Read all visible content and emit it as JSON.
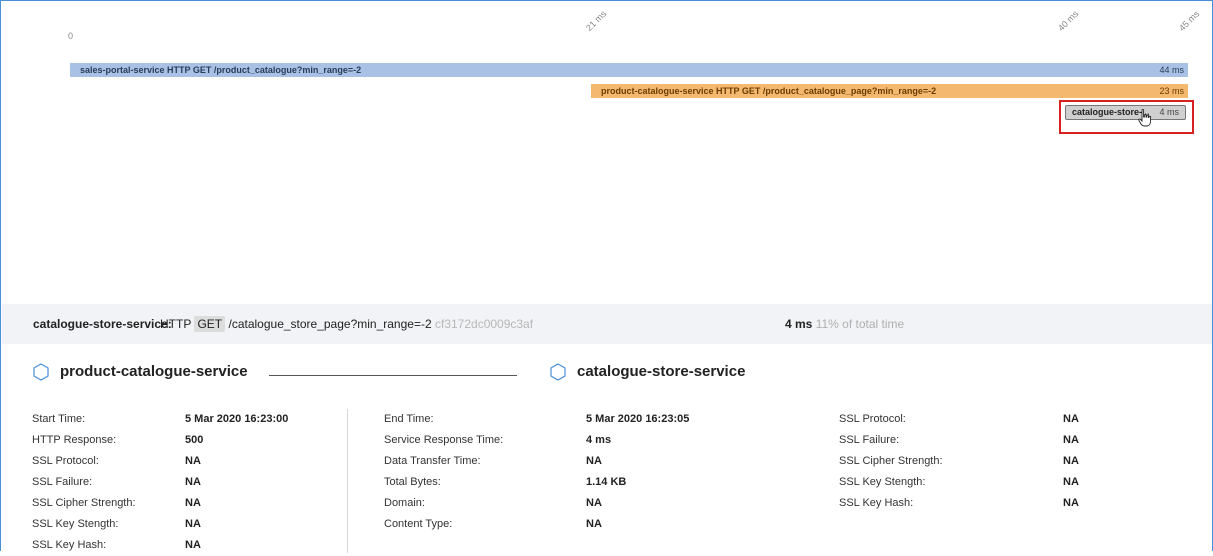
{
  "timeline": {
    "ticks": [
      "0",
      "21 ms",
      "40 ms",
      "45 ms"
    ],
    "spans": [
      {
        "label": "sales-portal-service HTTP GET /product_catalogue?min_range=-2",
        "duration": "44 ms",
        "color": "#a9c1e4"
      },
      {
        "label": "product-catalogue-service HTTP GET /product_catalogue_page?min_range=-2",
        "duration": "23 ms",
        "color": "#f5b86f"
      },
      {
        "label": "catalogue-store-...",
        "duration": "4 ms",
        "color": "#cfcfcf"
      }
    ]
  },
  "detail": {
    "service": "catalogue-store-service:",
    "protocol": "HTTP",
    "method": "GET",
    "path": "/catalogue_store_page?min_range=-2",
    "trace_id": "cf3172dc0009c3af",
    "duration": "4 ms",
    "share": "11% of total time"
  },
  "services": {
    "left": "product-catalogue-service",
    "right": "catalogue-store-service"
  },
  "table": {
    "col1": [
      {
        "k": "Start Time:",
        "v": "5 Mar 2020 16:23:00"
      },
      {
        "k": "HTTP Response:",
        "v": "500"
      },
      {
        "k": "SSL Protocol:",
        "v": "NA"
      },
      {
        "k": "SSL Failure:",
        "v": "NA"
      },
      {
        "k": "SSL Cipher Strength:",
        "v": "NA"
      },
      {
        "k": "SSL Key Stength:",
        "v": "NA"
      },
      {
        "k": "SSL Key Hash:",
        "v": "NA"
      }
    ],
    "col2": [
      {
        "k": "End Time:",
        "v": "5 Mar 2020 16:23:05"
      },
      {
        "k": "Service Response Time:",
        "v": "4 ms"
      },
      {
        "k": "Data Transfer Time:",
        "v": "NA"
      },
      {
        "k": "Total Bytes:",
        "v": "1.14 KB"
      },
      {
        "k": "Domain:",
        "v": "NA"
      },
      {
        "k": "Content Type:",
        "v": "NA"
      }
    ],
    "col3": [
      {
        "k": "SSL Protocol:",
        "v": "NA"
      },
      {
        "k": "SSL Failure:",
        "v": "NA"
      },
      {
        "k": "SSL Cipher Strength:",
        "v": "NA"
      },
      {
        "k": "SSL Key Stength:",
        "v": "NA"
      },
      {
        "k": "SSL Key Hash:",
        "v": "NA"
      }
    ]
  },
  "colors": {
    "accent": "#4a90d9",
    "highlight": "#d82121"
  },
  "icons": {
    "service": "hexagon-icon",
    "cursor": "hand-pointer-icon"
  }
}
